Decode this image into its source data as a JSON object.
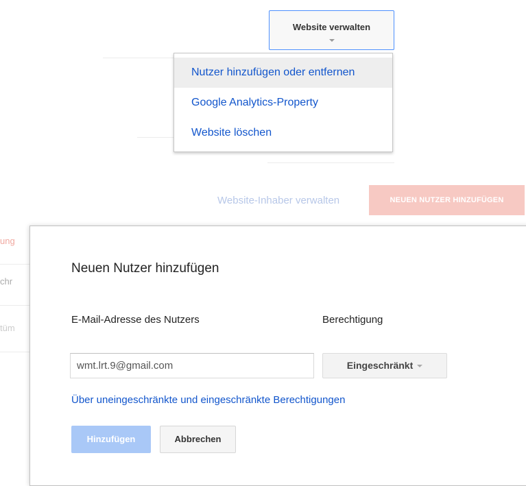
{
  "manage_button": {
    "label": "Website verwalten"
  },
  "menu": {
    "items": [
      {
        "label": "Nutzer hinzufügen oder entfernen"
      },
      {
        "label": "Google Analytics-Property"
      },
      {
        "label": "Website löschen"
      }
    ]
  },
  "background": {
    "owner_link": "Website-Inhaber verwalten",
    "new_user_button": "NEUEN NUTZER HINZUFÜGEN",
    "side_fragments": [
      "ung",
      "chr",
      "tüm"
    ]
  },
  "dialog": {
    "title": "Neuen Nutzer hinzufügen",
    "email_label": "E-Mail-Adresse des Nutzers",
    "permission_label": "Berechtigung",
    "email_value": "wmt.lrt.9@gmail.com",
    "permission_value": "Eingeschränkt",
    "info_link": "Über uneingeschränkte und eingeschränkte Berechtigungen",
    "add_button": "Hinzufügen",
    "cancel_button": "Abbrechen"
  },
  "colors": {
    "link": "#1155cc",
    "focus_border": "#4d90fe",
    "primary_disabled": "#a9c8f7",
    "danger_faded": "#f7c9c3"
  }
}
